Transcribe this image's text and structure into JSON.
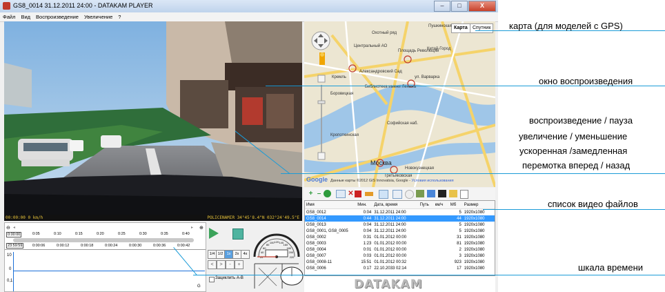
{
  "window": {
    "title": "GS8_0014   31.12.2011 24:00 - DATAKAM PLAYER",
    "minimize": "–",
    "maximize": "□",
    "close": "X"
  },
  "menu": [
    "Файл",
    "Вид",
    "Воспроизведение",
    "Увеличение",
    "?"
  ],
  "video": {
    "osd_left": "00:00:00 0 km/h",
    "osd_right": "POLICENAMIR 34°45'8.4\"N 032°24'49.5\"E"
  },
  "map": {
    "type_map": "Карта",
    "type_satellite": "Спутник",
    "labels": {
      "center": "Центральный АО",
      "okhotny": "Охотный ряд",
      "ploshad": "Площадь Революции",
      "kitay": "Китай-Город",
      "pushkinskaya": "Пушкинская",
      "kreml": "Кремль",
      "borovitskaya": "Боровицкая",
      "biblioteka": "Библиотека имени Ленина",
      "alexsad": "Александровский Сад",
      "varvarka": "ул. Варварка",
      "kropotkinskaya": "Кропоткинская",
      "sofiyskaya": "Софийская наб.",
      "moskva": "Москва",
      "novokuz": "Новокузнецкая",
      "tretyakov": "Третьяковская"
    },
    "google": "Google",
    "copyright": "Данные карты ©2012 GIS Innovatsia, Google -",
    "terms": "Условия использования"
  },
  "toolbar": {
    "add": "+",
    "remove": "–",
    "delete": "✕"
  },
  "file_list": {
    "columns": [
      "Имя",
      "Мин.",
      "Дата, время",
      "Путь",
      "км/ч",
      "Мб",
      "Размер"
    ],
    "rows": [
      [
        "GS8_0012",
        "0:04",
        "31.12.2011 24:00",
        "",
        "",
        "5",
        "1920x1080"
      ],
      [
        "GS8_0014",
        "0:44",
        "31.12.2011 24:00",
        "",
        "",
        "44",
        "1920x1080"
      ],
      [
        "GS8_0013",
        "0:04",
        "31.12.2011 24:00",
        "",
        "",
        "5",
        "1920x1080"
      ],
      [
        "GS8_0001, GS8_0005",
        "0:04",
        "31.12.2011 24:00",
        "",
        "",
        "5",
        "1920x1080"
      ],
      [
        "GS8_0002",
        "0:31",
        "01.01.2012 00:00",
        "",
        "",
        "31",
        "1920x1080"
      ],
      [
        "GS8_0003",
        "1:23",
        "01.01.2012 00:00",
        "",
        "",
        "81",
        "1920x1080"
      ],
      [
        "GS8_0004",
        "0:01",
        "01.01.2012 00:00",
        "",
        "",
        "2",
        "1920x1080"
      ],
      [
        "GS8_0007",
        "0:03",
        "01.01.2012 00:00",
        "",
        "",
        "3",
        "1920x1080"
      ],
      [
        "GS8_0008-11",
        "15:51",
        "01.01.2012 00:32",
        "",
        "",
        "923",
        "1920x1080"
      ],
      [
        "GS8_0006",
        "0:17",
        "22.10.2033 02:14",
        "",
        "",
        "17",
        "1920x1080"
      ]
    ],
    "selected_index": 1
  },
  "logo": "DATAKAM",
  "timeline": {
    "start": "0:00:00",
    "current": "23:59:59",
    "scale_top": [
      "0:05",
      "0:10",
      "0:15",
      "0:20",
      "0:25",
      "0:30",
      "0:35",
      "0:40"
    ],
    "scale_bottom": [
      "0:00:06",
      "0:00:12",
      "0:00:18",
      "0:00:24",
      "0:00:30",
      "0:00:36",
      "0:00:42"
    ],
    "y_labels": [
      "10",
      "0",
      "0,1"
    ],
    "g_label": "G"
  },
  "controls": {
    "speeds": [
      "1/4",
      "1/2",
      "1x",
      "2x",
      "4x"
    ],
    "active_speed_index": 2,
    "nav": [
      "<",
      ">",
      "-",
      "+"
    ],
    "loop_ab": "Зациклить A-B",
    "speedo_ticks": [
      "20",
      "40",
      "60",
      "80",
      "100",
      "120",
      "140",
      "160",
      "180",
      "200",
      "220"
    ]
  },
  "callouts": {
    "map": "карта (для моделей с GPS)",
    "playback_window": "окно воспроизведения",
    "controls_1": "воспроизведение / пауза",
    "controls_2": "увеличение / уменьшение",
    "controls_3": "ускоренная /замедленная",
    "controls_4": "перемотка вперед / назад",
    "file_list": "список видео файлов",
    "timeline": "шкала времени"
  }
}
